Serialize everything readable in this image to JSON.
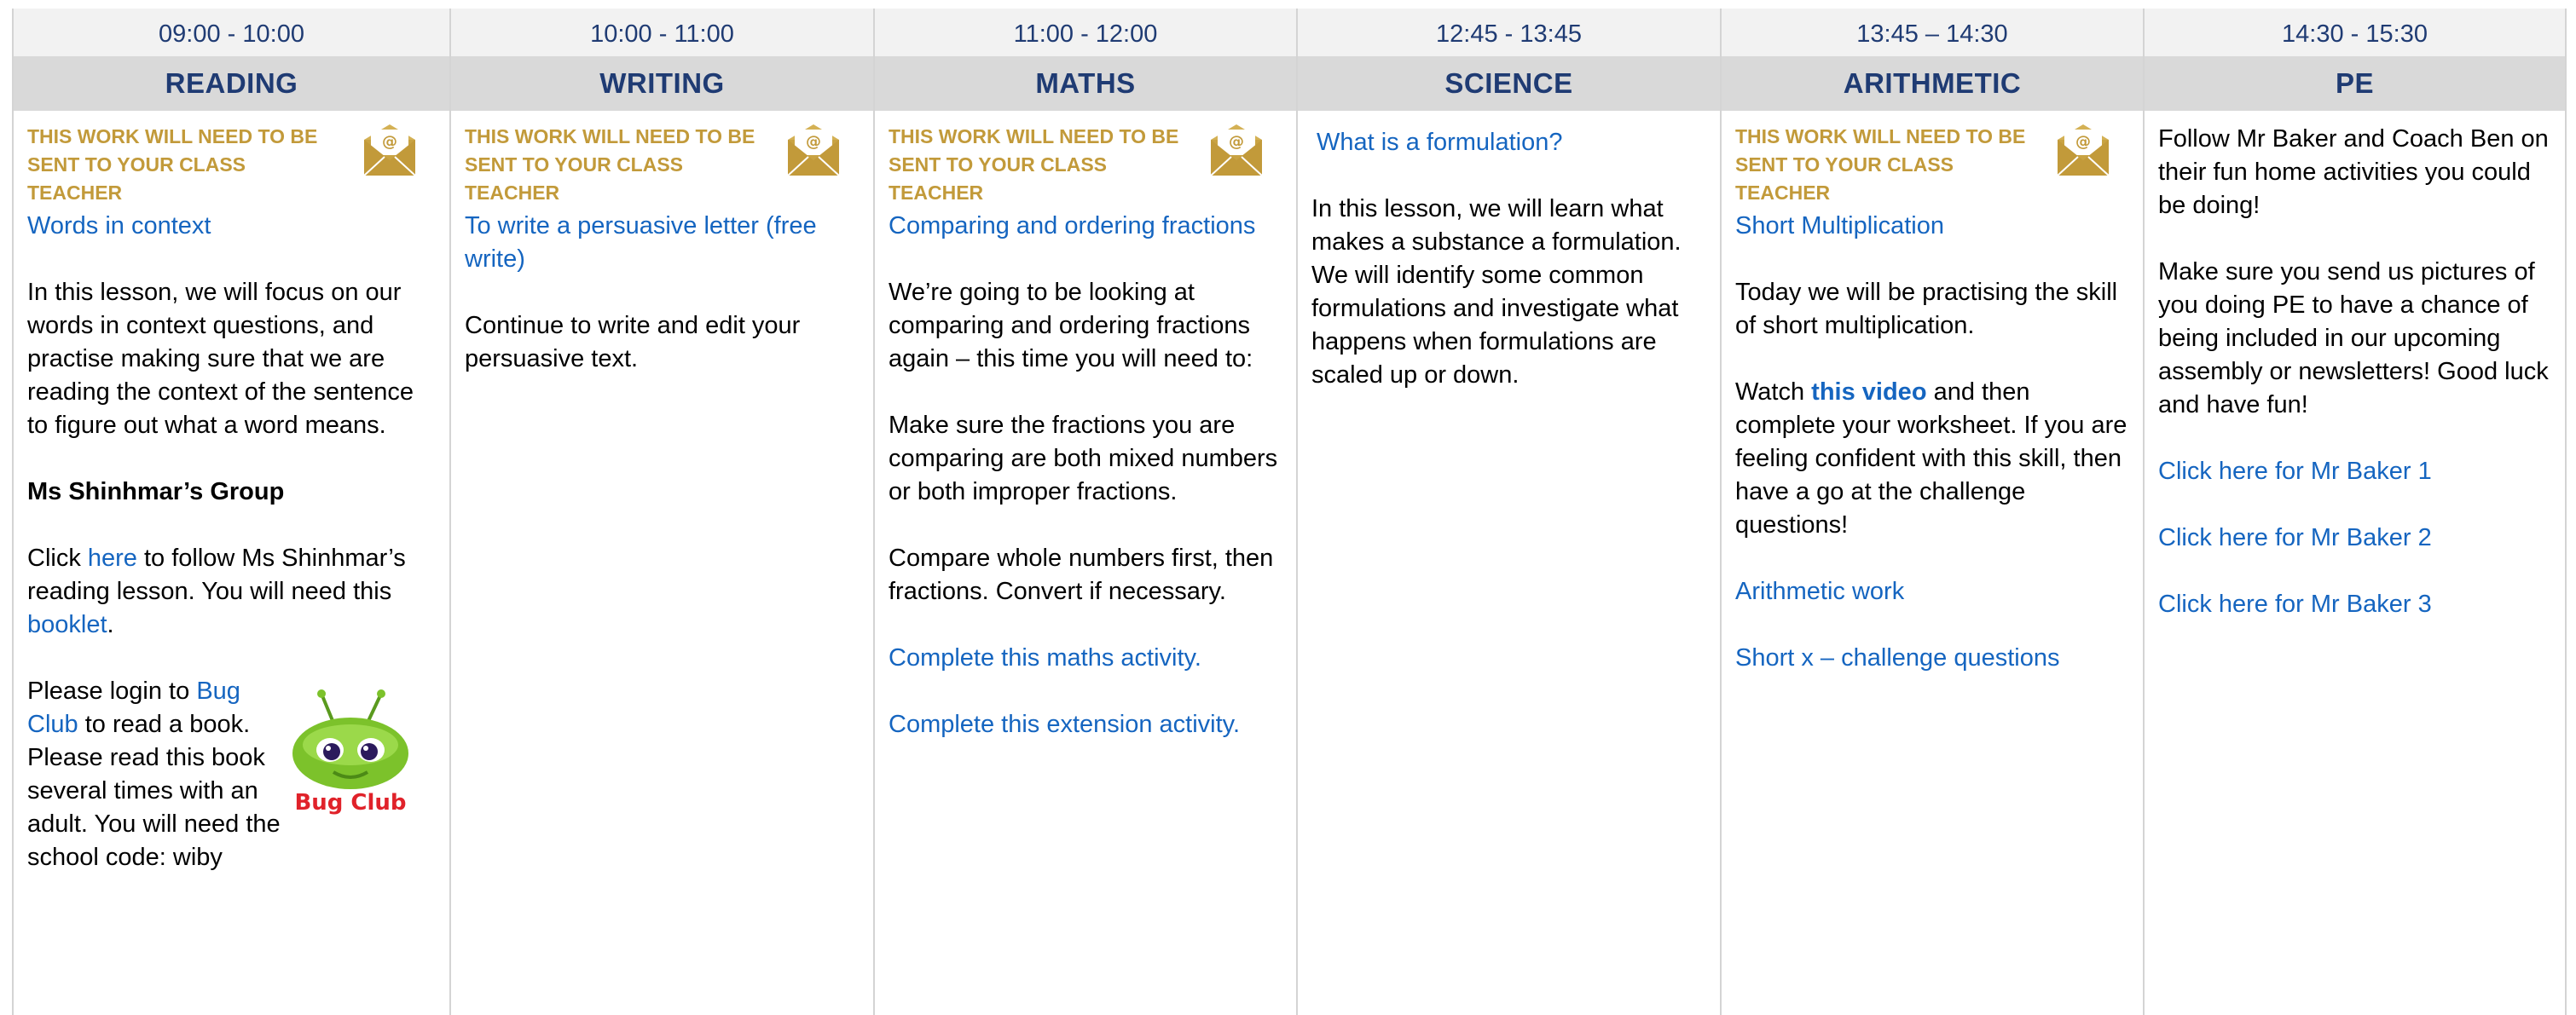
{
  "send_notice": "THIS WORK WILL NEED TO BE SENT TO YOUR CLASS TEACHER",
  "columns": [
    {
      "time": "09:00 - 10:00",
      "subject": "READING",
      "title": "Words in context",
      "intro": "In this lesson, we will focus on our words in context questions, and practise making sure that we are reading the context of the sentence to figure out what a word means.",
      "group_heading": "Ms Shinhmar’s Group",
      "click_prefix": "Click ",
      "click_link": "here",
      "click_middle": " to follow Ms Shinhmar’s reading lesson. You will need this ",
      "booklet_link": "booklet",
      "click_suffix": ".",
      "login_prefix": "Please login to ",
      "bug_club_link": "Bug Club",
      "login_suffix": " to read a book. Please read this book several times with an adult. You will need the school code: wiby",
      "bug_logo_text": "Bug Club"
    },
    {
      "time": "10:00 - 11:00",
      "subject": "WRITING",
      "title": "To write a persuasive letter (free write)",
      "body": "Continue to write and edit your persuasive text."
    },
    {
      "time": "11:00 - 12:00",
      "subject": "MATHS",
      "title": "Comparing and ordering fractions",
      "p1": "We’re going to be looking at comparing and ordering fractions again – this time you will need to:",
      "p2": "Make sure the fractions you are comparing are both mixed numbers or both improper fractions.",
      "p3": "Compare whole numbers first, then fractions. Convert if necessary.",
      "link1": "Complete this maths activity.",
      "link2": "Complete this extension activity."
    },
    {
      "time": "12:45 - 13:45",
      "subject": "SCIENCE",
      "title": "What is a formulation?",
      "body": "In this lesson, we will learn what makes a substance a formulation. We will identify some common formulations and investigate what happens when formulations are scaled up or down."
    },
    {
      "time": "13:45 – 14:30",
      "subject": "ARITHMETIC",
      "title": "Short Multiplication",
      "p1": "Today we will be practising the skill of short multiplication.",
      "watch_prefix": "Watch ",
      "watch_link": "this video",
      "watch_suffix": " and then complete your worksheet. If you are feeling confident with this skill, then have a go at the challenge questions!",
      "link1": "Arithmetic work",
      "link2": "Short x – challenge questions"
    },
    {
      "time": "14:30 - 15:30",
      "subject": "PE",
      "p1": "Follow Mr Baker and Coach Ben on their fun home activities you could be doing!",
      "p2": "Make sure you send us pictures of you doing PE to have a chance of being included in our upcoming assembly or newsletters! Good luck and have fun!",
      "link1": "Click here for Mr Baker 1",
      "link2": "Click here for Mr Baker 2",
      "link3": "Click here for Mr Baker 3"
    }
  ],
  "colors": {
    "header_text": "#1f3b73",
    "notice_gold": "#c29a3a",
    "link_blue": "#1565c0",
    "time_row_bg": "#f2f2f2",
    "subject_row_bg": "#d9d9d9",
    "bug_green": "#7cc22b",
    "bug_red": "#e0222a"
  },
  "icons": {
    "mail": "envelope-at-icon",
    "bug_club": "bug-club-logo"
  }
}
